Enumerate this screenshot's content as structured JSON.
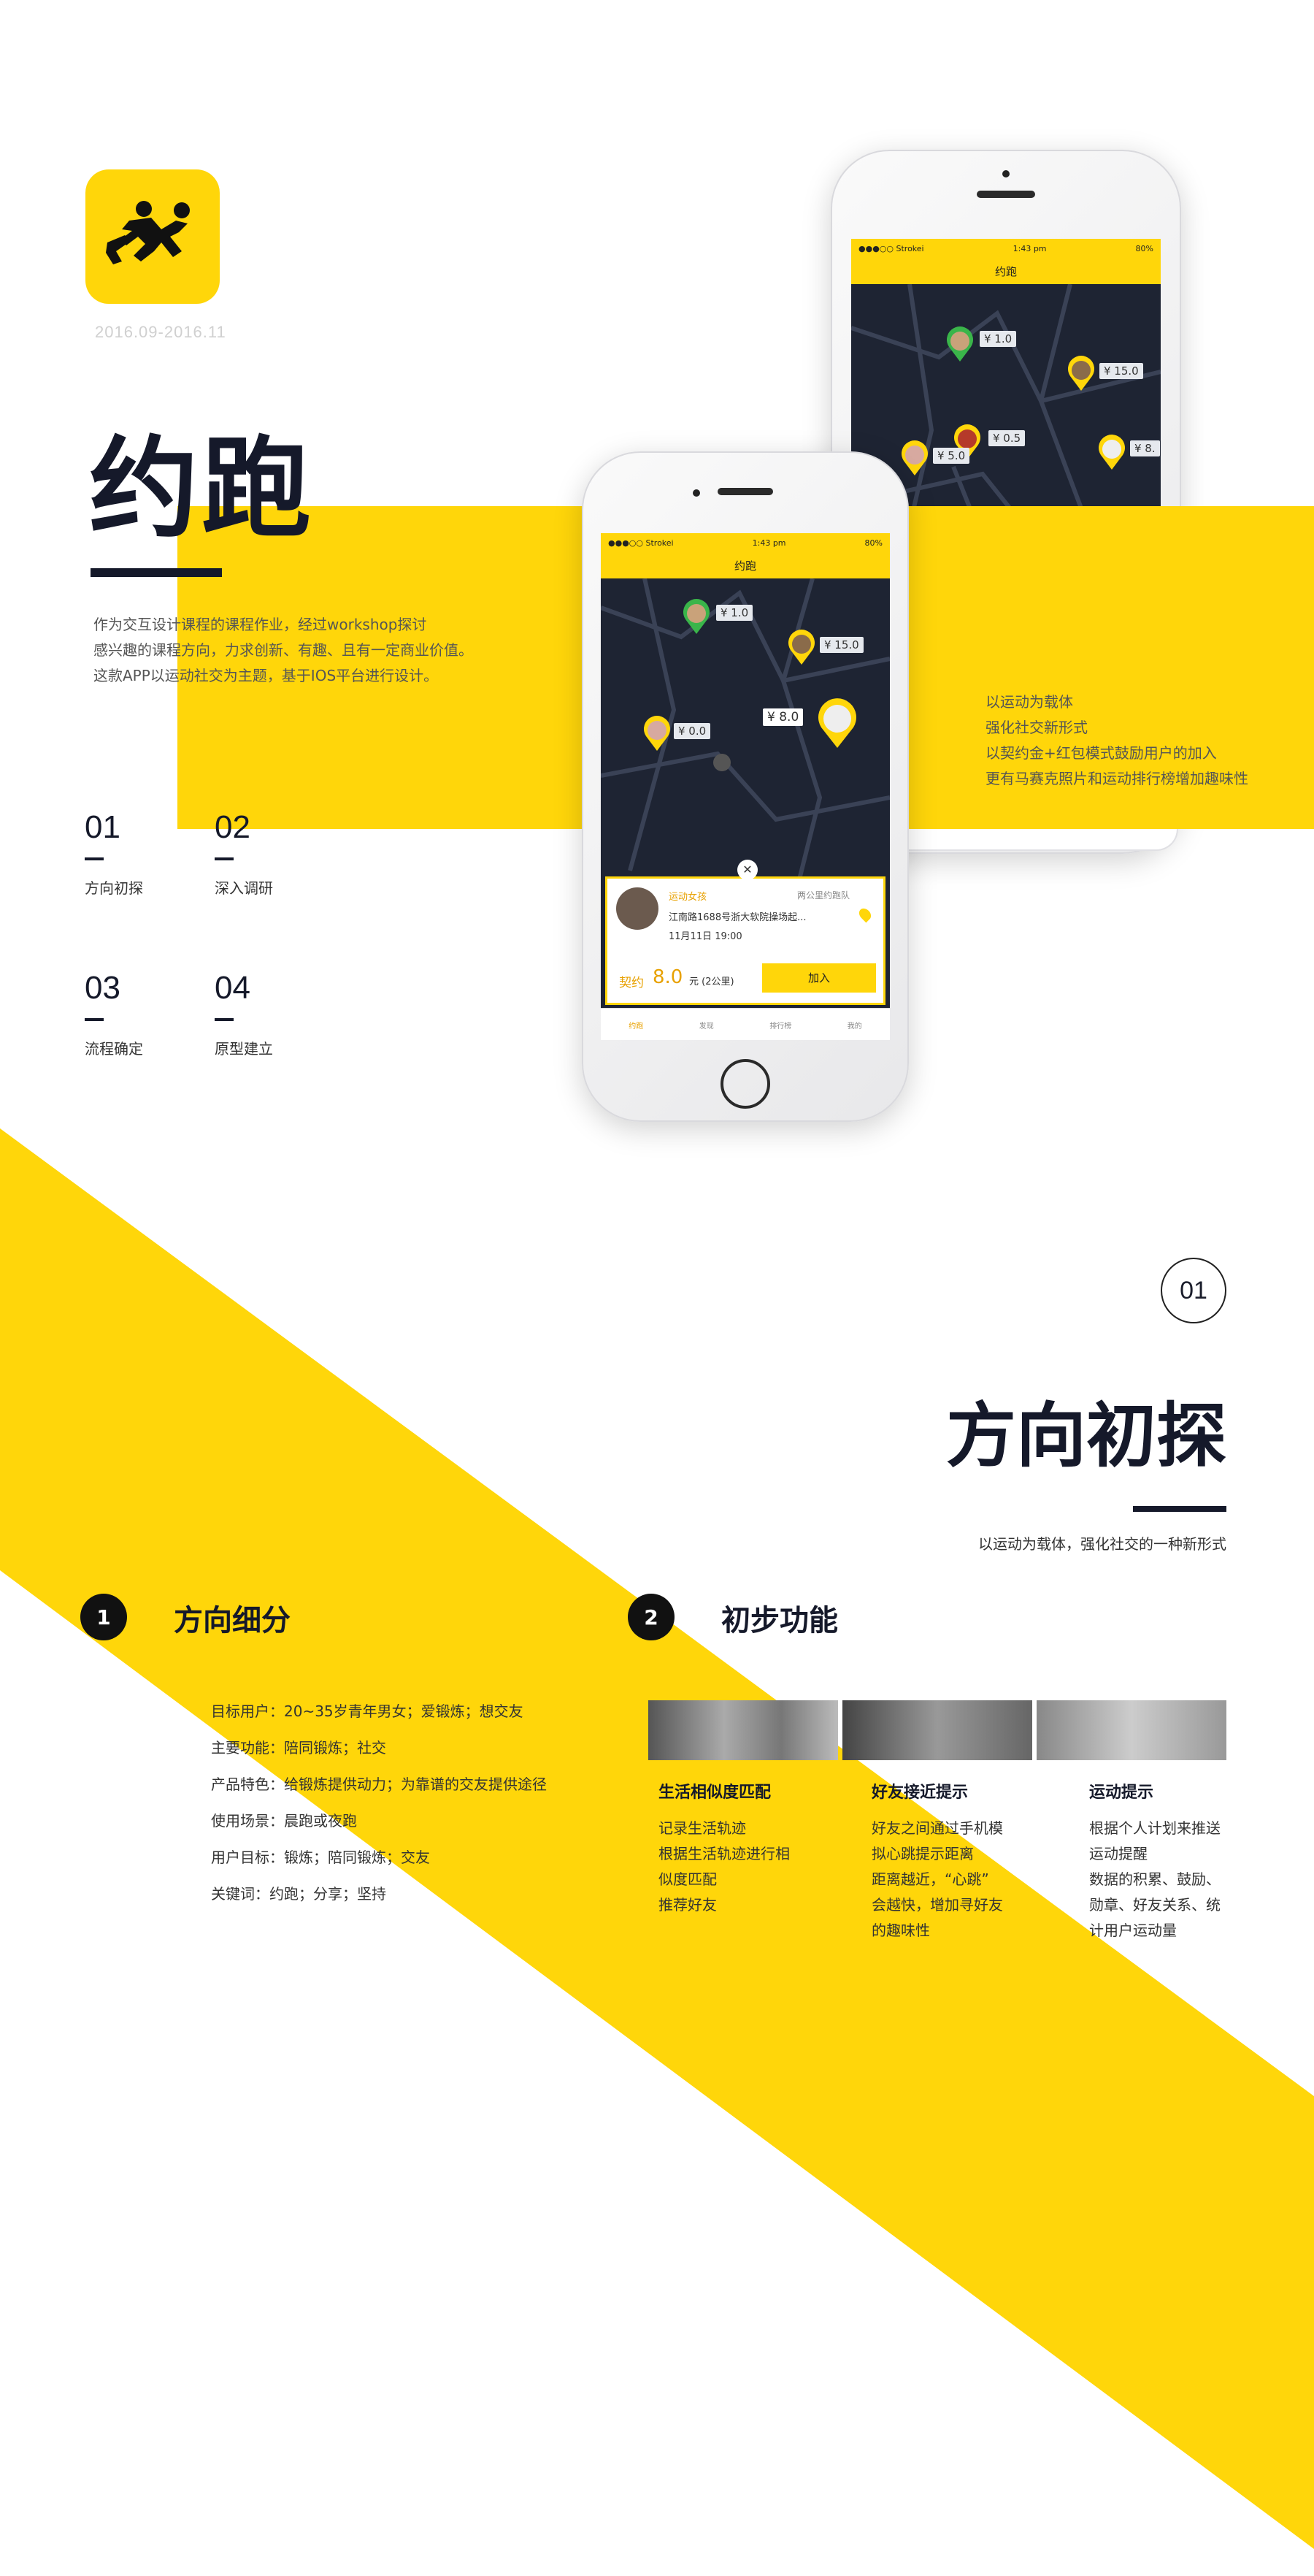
{
  "brand": {
    "app_name": "约跑",
    "dates": "2016.09-2016.11",
    "accent": "#ffd60a",
    "dark": "#15192a"
  },
  "intro": {
    "lines": [
      "作为交互设计课程的课程作业，经过workshop探讨",
      "感兴趣的课程方向，力求创新、有趣、且有一定商业价值。",
      "这款APP以运动社交为主题，基于IOS平台进行设计。"
    ]
  },
  "features": {
    "lines": [
      "以运动为载体",
      "强化社交新形式",
      "以契约金+红包模式鼓励用户的加入",
      "更有马赛克照片和运动排行榜增加趣味性"
    ]
  },
  "steps": [
    {
      "num": "01",
      "label": "方向初探"
    },
    {
      "num": "02",
      "label": "深入调研"
    },
    {
      "num": "03",
      "label": "流程确定"
    },
    {
      "num": "04",
      "label": "原型建立"
    }
  ],
  "phone_back": {
    "carrier": "●●●○○ Strokei",
    "time": "1:43 pm",
    "battery": "80%",
    "nav_title": "约跑",
    "prices": [
      "¥ 1.0",
      "¥ 15.0",
      "¥ 0.5",
      "¥ 5.0",
      "¥ 8."
    ]
  },
  "phone_front": {
    "carrier": "●●●○○ Strokei",
    "time": "1:43 pm",
    "battery": "80%",
    "nav_title": "约跑",
    "prices": [
      "¥ 1.0",
      "¥ 15.0",
      "¥ 8.0",
      "¥ 0.0"
    ],
    "card": {
      "tag": "运动女孩",
      "distance": "两公里约跑队",
      "address": "江南路1688号浙大软院操场起...",
      "datetime": "11月11日 19:00",
      "deposit_label": "契约",
      "deposit_value": "8.0",
      "deposit_unit": "元 (2公里)",
      "join_button": "加入"
    },
    "tabs": [
      "约跑",
      "发现",
      "排行榜",
      "我的"
    ]
  },
  "section1": {
    "number": "01",
    "title": "方向初探",
    "subtitle": "以运动为载体，强化社交的一种新形式",
    "part1": {
      "index": "1",
      "heading": "方向细分",
      "items": [
        "目标用户：20~35岁青年男女；爱锻炼；想交友",
        "主要功能：陪同锻炼；社交",
        "产品特色：给锻炼提供动力；为靠谱的交友提供途径",
        "使用场景：晨跑或夜跑",
        "用户目标：锻炼；陪同锻炼；交友",
        "关键词：约跑；分享；坚持"
      ]
    },
    "part2": {
      "index": "2",
      "heading": "初步功能",
      "columns": [
        {
          "title": "生活相似度匹配",
          "lines": [
            "记录生活轨迹",
            "根据生活轨迹进行相",
            "似度匹配",
            "推荐好友"
          ]
        },
        {
          "title": "好友接近提示",
          "lines": [
            "好友之间通过手机模",
            "拟心跳提示距离",
            "距离越近，“心跳”",
            "会越快，增加寻好友",
            "的趣味性"
          ]
        },
        {
          "title": "运动提示",
          "lines": [
            "根据个人计划来推送",
            "运动提醒",
            "数据的积累、鼓励、",
            "勋章、好友关系、统",
            "计用户运动量"
          ]
        }
      ]
    }
  }
}
